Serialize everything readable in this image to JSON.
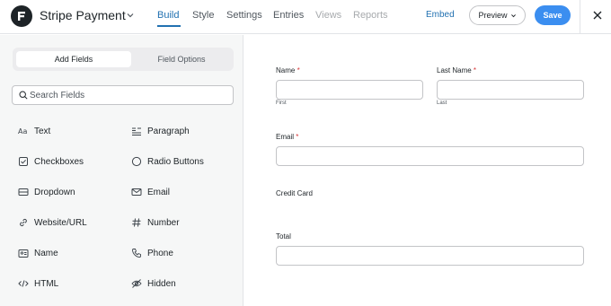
{
  "header": {
    "form_title": "Stripe Payment",
    "tabs": [
      {
        "label": "Build",
        "state": "active"
      },
      {
        "label": "Style",
        "state": "normal"
      },
      {
        "label": "Settings",
        "state": "normal"
      },
      {
        "label": "Entries",
        "state": "normal"
      },
      {
        "label": "Views",
        "state": "disabled"
      },
      {
        "label": "Reports",
        "state": "disabled"
      }
    ],
    "embed_label": "Embed",
    "preview_label": "Preview",
    "save_label": "Save",
    "icons": {
      "logo": "formidable-logo-icon",
      "title_chevron": "chevron-down-icon",
      "close": "close-icon"
    },
    "colors": {
      "accent": "#2271b1",
      "save": "#3b8ef0"
    }
  },
  "sidebar": {
    "tabs": [
      {
        "label": "Add Fields",
        "state": "active"
      },
      {
        "label": "Field Options",
        "state": "normal"
      }
    ],
    "search": {
      "placeholder": "Search Fields",
      "value": ""
    },
    "fields": [
      {
        "label": "Text",
        "icon": "text-icon"
      },
      {
        "label": "Paragraph",
        "icon": "paragraph-icon"
      },
      {
        "label": "Checkboxes",
        "icon": "checkbox-icon"
      },
      {
        "label": "Radio Buttons",
        "icon": "radio-icon"
      },
      {
        "label": "Dropdown",
        "icon": "dropdown-icon"
      },
      {
        "label": "Email",
        "icon": "email-icon"
      },
      {
        "label": "Website/URL",
        "icon": "link-icon"
      },
      {
        "label": "Number",
        "icon": "hash-icon"
      },
      {
        "label": "Name",
        "icon": "name-card-icon"
      },
      {
        "label": "Phone",
        "icon": "phone-icon"
      },
      {
        "label": "HTML",
        "icon": "code-icon"
      },
      {
        "label": "Hidden",
        "icon": "eye-off-icon"
      }
    ]
  },
  "form": {
    "name": {
      "label": "Name",
      "required_mark": "*",
      "sub_first": "First",
      "value_first": ""
    },
    "last_name": {
      "label": "Last Name",
      "required_mark": "*",
      "sub_last": "Last",
      "value": ""
    },
    "email": {
      "label": "Email",
      "required_mark": "*",
      "value": ""
    },
    "credit_card": {
      "label": "Credit Card"
    },
    "total": {
      "label": "Total",
      "value": ""
    }
  }
}
